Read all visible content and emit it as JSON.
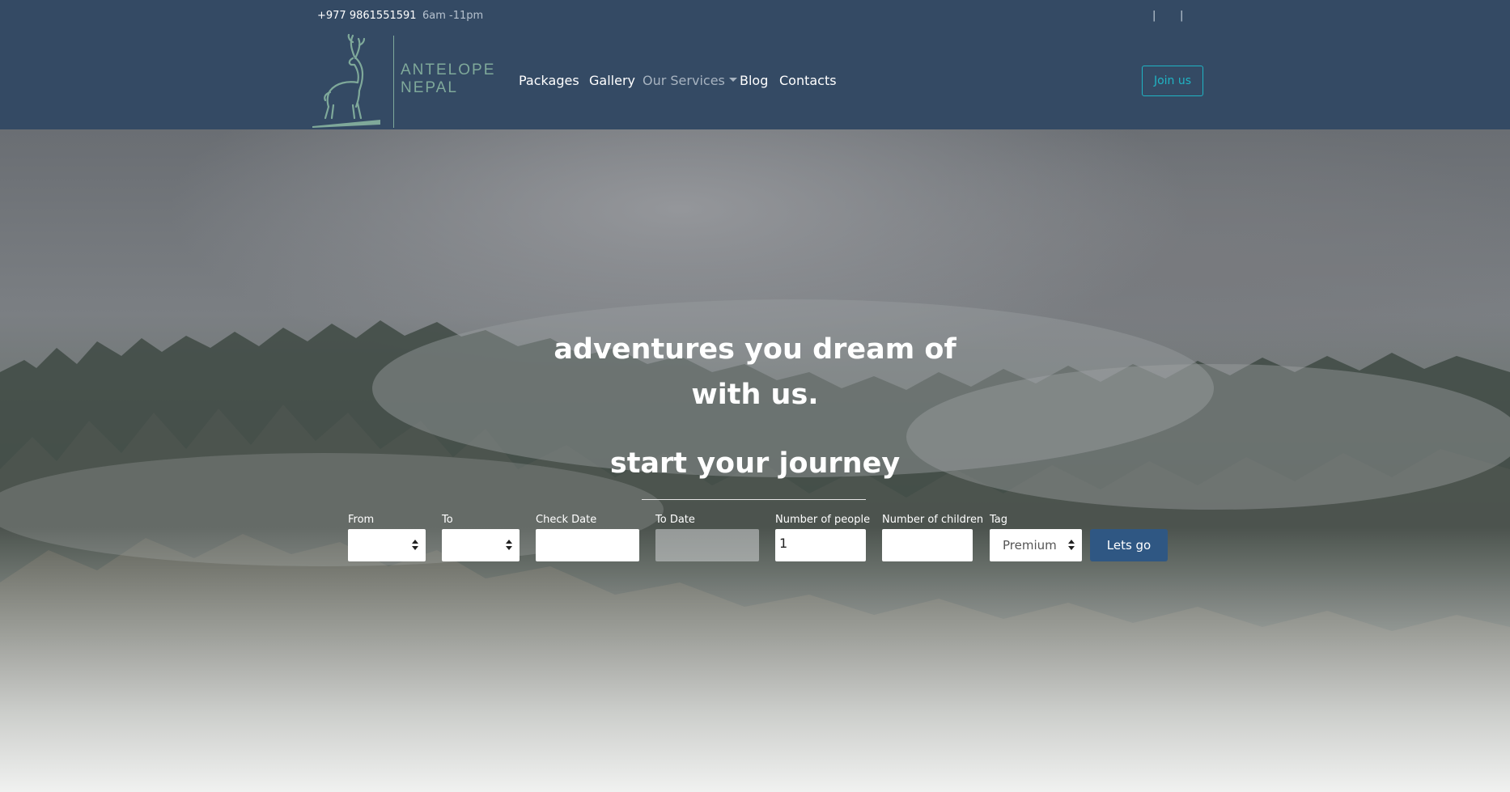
{
  "topbar": {
    "phone": "+977 9861551591",
    "hours": "6am -11pm",
    "separators": [
      "|",
      "|"
    ]
  },
  "brand": {
    "line1": "ANTELOPE",
    "line2": "NEPAL",
    "logo_icon": "antelope-icon",
    "accent": "#7fa99a"
  },
  "nav": {
    "items": [
      {
        "label": "Packages"
      },
      {
        "label": "Gallery"
      },
      {
        "label": "Our Services",
        "dropdown": true
      },
      {
        "label": "Blog"
      },
      {
        "label": "Contacts"
      }
    ],
    "join_label": "Join us"
  },
  "hero": {
    "title_line1": "adventures you dream of",
    "title_line2": "with us.",
    "subtitle": "start your journey"
  },
  "form": {
    "from_label": "From",
    "to_label": "To",
    "check_date_label": "Check Date",
    "to_date_label": "To Date",
    "people_label": "Number of people",
    "people_value": "1",
    "children_label": "Number of children",
    "tag_label": "Tag",
    "tag_value": "Premium",
    "submit_label": "Lets go"
  },
  "colors": {
    "header_bg": "#344a64",
    "join_accent": "#1fb4c4",
    "button_bg": "#2f5783"
  }
}
